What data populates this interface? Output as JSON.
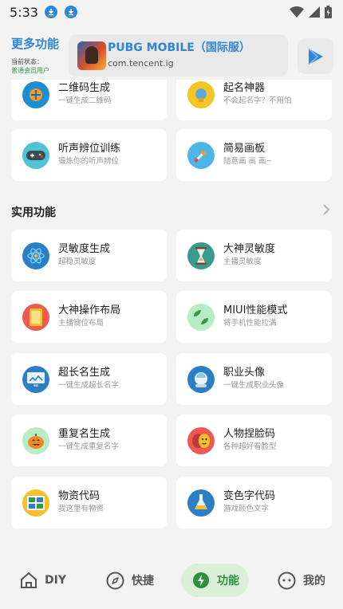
{
  "status_bar": {
    "time": "5:33"
  },
  "header": {
    "title": "更多功能",
    "status_label": "当前状态：",
    "user_type": "普通会员用户",
    "game": {
      "name": "PUBG MOBILE（国际服）",
      "package": "com.tencent.ig"
    }
  },
  "top_cards": [
    {
      "title": "二维码生成",
      "subtitle": "一键生成二维码",
      "icon": "qrcode-icon"
    },
    {
      "title": "起名神器",
      "subtitle": "不会起名字？不用怕",
      "icon": "name-icon"
    },
    {
      "title": "听声辨位训练",
      "subtitle": "锻炼你的听声辨位",
      "icon": "gamepad-icon"
    },
    {
      "title": "简易画板",
      "subtitle": "随意画 画 画~",
      "icon": "paint-icon"
    }
  ],
  "section": {
    "title": "实用功能"
  },
  "cards": [
    {
      "title": "灵敏度生成",
      "subtitle": "超稳灵敏度",
      "icon": "atom-icon"
    },
    {
      "title": "大神灵敏度",
      "subtitle": "主播灵敏度",
      "icon": "hourglass-icon"
    },
    {
      "title": "大神操作布局",
      "subtitle": "主播键位布局",
      "icon": "layout-icon"
    },
    {
      "title": "MIUI性能模式",
      "subtitle": "将手机性能拉满",
      "icon": "leaf-icon"
    },
    {
      "title": "超长名生成",
      "subtitle": "一键生成超长名字",
      "icon": "monitor-icon"
    },
    {
      "title": "职业头像",
      "subtitle": "一键生成职业头像",
      "icon": "astronaut-icon"
    },
    {
      "title": "重复名生成",
      "subtitle": "一键生成重复名字",
      "icon": "pumpkin-icon"
    },
    {
      "title": "人物捏脸码",
      "subtitle": "各种超好看脸型",
      "icon": "mask-icon"
    },
    {
      "title": "物资代码",
      "subtitle": "我这里有物资",
      "icon": "grid-icon"
    },
    {
      "title": "变色字代码",
      "subtitle": "游戏颜色文字",
      "icon": "flask-icon"
    }
  ],
  "nav": [
    {
      "label": "DIY",
      "icon": "home-icon"
    },
    {
      "label": "快捷",
      "icon": "compass-icon"
    },
    {
      "label": "功能",
      "icon": "bolt-icon",
      "active": true
    },
    {
      "label": "我的",
      "icon": "face-icon"
    }
  ],
  "colors": {
    "accent_blue": "#2f86d8",
    "active_green": "#2e8f3e",
    "active_bg": "#dcefd9"
  }
}
